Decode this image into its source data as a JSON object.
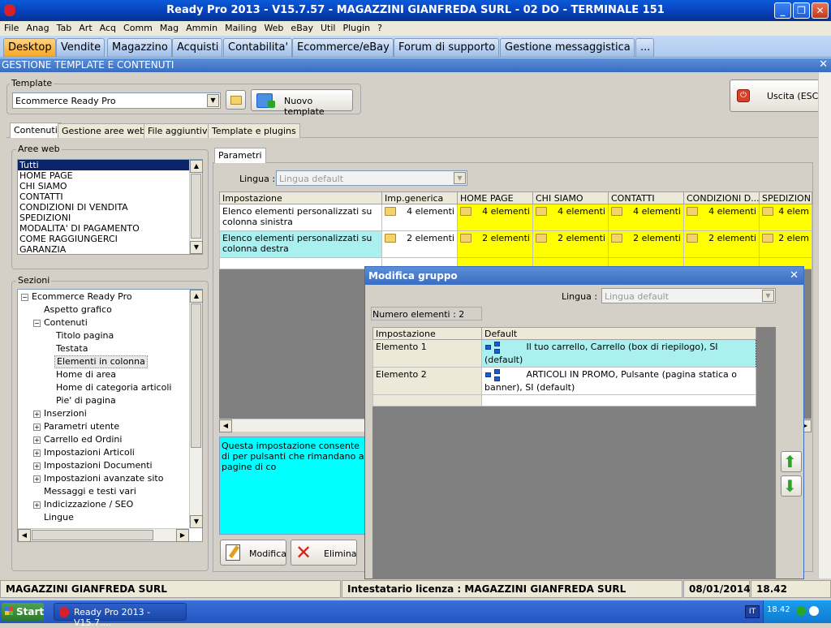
{
  "window": {
    "title": "Ready Pro 2013 - V15.7.57 - MAGAZZINI GIANFREDA SURL - 02 DO - TERMINALE 151",
    "min": "_",
    "max": "❐",
    "close": "✕"
  },
  "menu": [
    "File",
    "Anag",
    "Tab",
    "Art",
    "Acq",
    "Comm",
    "Mag",
    "Ammin",
    "Mailing",
    "Web",
    "eBay",
    "Util",
    "Plugin",
    "?"
  ],
  "modules": [
    "Desktop",
    "Vendite",
    "Magazzino",
    "Acquisti",
    "Contabilita'",
    "Ecommerce/eBay",
    "Forum di supporto",
    "Gestione messaggistica",
    "..."
  ],
  "section": {
    "title": "GESTIONE TEMPLATE E CONTENUTI",
    "close": "✕"
  },
  "template": {
    "legend": "Template",
    "value": "Ecommerce Ready Pro",
    "new_label": "Nuovo template"
  },
  "exit_label": "Uscita (ESC)",
  "subtabs": [
    "Contenuti",
    "Gestione aree web",
    "File aggiuntivi",
    "Template e plugins"
  ],
  "aree": {
    "legend": "Aree web",
    "items": [
      "Tutti",
      "HOME PAGE",
      "CHI SIAMO",
      "CONTATTI",
      "CONDIZIONI DI VENDITA",
      "SPEDIZIONI",
      "MODALITA' DI PAGAMENTO",
      "COME RAGGIUNGERCI",
      "GARANZIA"
    ]
  },
  "sezioni": {
    "legend": "Sezioni",
    "items": [
      {
        "label": "Ecommerce Ready Pro",
        "pm": "−",
        "level": 0
      },
      {
        "label": "Aspetto grafico",
        "pm": "",
        "level": 1
      },
      {
        "label": "Contenuti",
        "pm": "−",
        "level": 1
      },
      {
        "label": "Titolo pagina",
        "pm": "",
        "level": 2
      },
      {
        "label": "Testata",
        "pm": "",
        "level": 2
      },
      {
        "label": "Elementi in colonna",
        "pm": "",
        "level": 2
      },
      {
        "label": "Home di area",
        "pm": "",
        "level": 2
      },
      {
        "label": "Home di categoria articoli",
        "pm": "",
        "level": 2
      },
      {
        "label": "Pie' di pagina",
        "pm": "",
        "level": 2
      },
      {
        "label": "Inserzioni",
        "pm": "+",
        "level": 1
      },
      {
        "label": "Parametri utente",
        "pm": "+",
        "level": 1
      },
      {
        "label": "Carrello ed Ordini",
        "pm": "+",
        "level": 1
      },
      {
        "label": "Impostazioni Articoli",
        "pm": "+",
        "level": 1
      },
      {
        "label": "Impostazioni Documenti",
        "pm": "+",
        "level": 1
      },
      {
        "label": "Impostazioni avanzate sito",
        "pm": "+",
        "level": 1
      },
      {
        "label": "Messaggi e testi vari",
        "pm": "",
        "level": 1
      },
      {
        "label": "Indicizzazione / SEO",
        "pm": "+",
        "level": 1
      },
      {
        "label": "Lingue",
        "pm": "",
        "level": 1
      }
    ]
  },
  "parametri": {
    "tab": "Parametri",
    "lingua_label": "Lingua :",
    "lingua_value": "Lingua default",
    "columns": [
      "Impostazione",
      "Imp.generica",
      "HOME PAGE",
      "CHI SIAMO",
      "CONTATTI",
      "CONDIZIONI D...",
      "SPEDIZIONI"
    ],
    "rows": [
      {
        "name": "Elenco elementi personalizzati su colonna sinistra",
        "values": [
          "4 elementi",
          "4 elementi",
          "4 elementi",
          "4 elementi",
          "4 elementi",
          "4 elem"
        ]
      },
      {
        "name": "Elenco elementi personalizzati su colonna destra",
        "values": [
          "2 elementi",
          "2 elementi",
          "2 elementi",
          "2 elementi",
          "2 elementi",
          "2 elem"
        ]
      }
    ],
    "description": "Questa impostazione consente di per pulsanti che rimandano a pagine di co",
    "modifica_label": "Modifica",
    "elimina_label": "Elimina"
  },
  "dialog": {
    "title": "Modifica gruppo",
    "close": "✕",
    "lingua_label": "Lingua :",
    "lingua_value": "Lingua default",
    "count_label": "Numero elementi : 2",
    "columns": [
      "Impostazione",
      "Default"
    ],
    "rows": [
      {
        "name": "Elemento 1",
        "value": "Il tuo carrello, Carrello (box di riepilogo), SI (default)"
      },
      {
        "name": "Elemento 2",
        "value": "ARTICOLI IN PROMO, Pulsante (pagina statica o banner), SI (default)"
      }
    ]
  },
  "status": {
    "company": "MAGAZZINI GIANFREDA SURL",
    "license": "Intestatario licenza : MAGAZZINI GIANFREDA SURL",
    "date": "08/01/2014",
    "time": "18.42"
  },
  "taskbar": {
    "start": "Start",
    "app": "Ready Pro 2013 - V15.7....",
    "lang": "IT",
    "clock": "18.42"
  }
}
